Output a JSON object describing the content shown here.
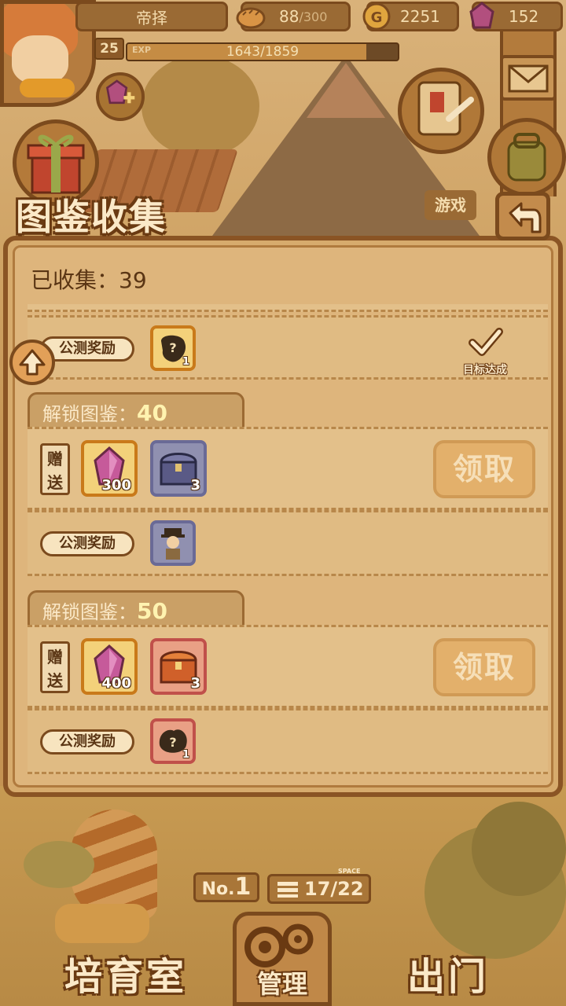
{
  "player": {
    "name": "帝择",
    "level": "25",
    "exp_label": "EXP",
    "exp_text": "1643/1859",
    "exp_fraction": 0.884
  },
  "resources": {
    "bread_current": "88",
    "bread_max": "/300",
    "gold": "2251",
    "gems": "152"
  },
  "side_menu": {
    "game_label": "游戏"
  },
  "page": {
    "title": "图鉴收集",
    "collected": "已收集：39"
  },
  "rewards": {
    "gift_label": "赠送",
    "beta_label": "公测奖励",
    "claim_label": "领取",
    "completed_label": "目标达成",
    "first_partial": {
      "beta_item_qty": "1"
    },
    "sections": [
      {
        "title_prefix": "解锁图鉴：",
        "title_number": "40",
        "gift_items": [
          {
            "icon": "pink-crystal",
            "qty": "300"
          },
          {
            "icon": "blue-chest",
            "qty": "3"
          }
        ],
        "beta_item": {
          "icon": "explorer-character",
          "qty": ""
        }
      },
      {
        "title_prefix": "解锁图鉴：",
        "title_number": "50",
        "gift_items": [
          {
            "icon": "pink-crystal",
            "qty": "400"
          },
          {
            "icon": "red-chest",
            "qty": "3"
          }
        ],
        "beta_item": {
          "icon": "mystery-creature",
          "qty": "1"
        }
      }
    ]
  },
  "bottom": {
    "no_prefix": "No.",
    "no_value": "1",
    "space_tag": "SPACE",
    "space_value": "17/22",
    "nursery_label": "培育室",
    "manage_label": "管理",
    "go_out_label": "出门"
  },
  "colors": {
    "panel_brown": "#8a5424",
    "panel_fill": "#deb57c",
    "accent_gold": "#fff3b0",
    "claim_disabled": "#e3b06b"
  }
}
